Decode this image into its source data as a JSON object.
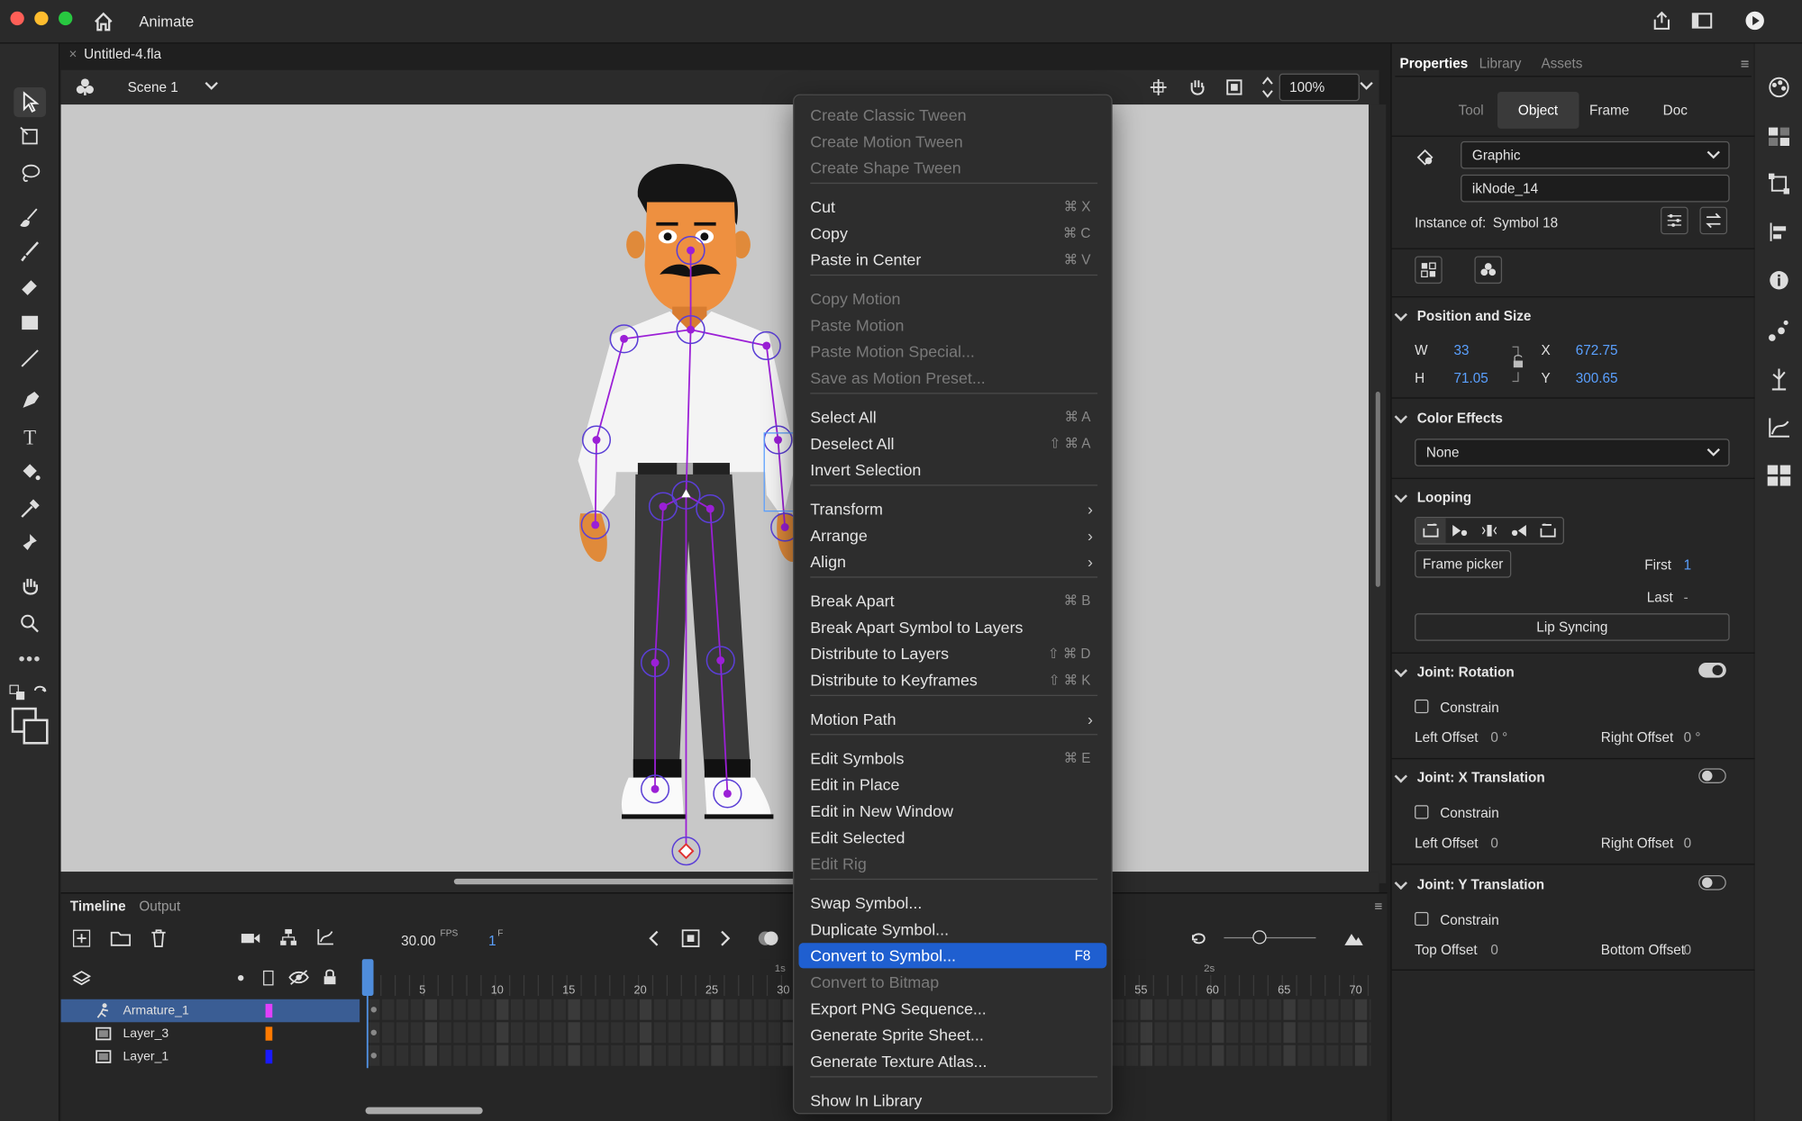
{
  "app": {
    "name": "Animate",
    "document_tab": "Untitled-4.fla"
  },
  "scene": {
    "label": "Scene 1",
    "zoom": "100%"
  },
  "menu": {
    "items": [
      {
        "label": "Create Classic Tween",
        "enabled": false
      },
      {
        "label": "Create Motion Tween",
        "enabled": false
      },
      {
        "label": "Create Shape Tween",
        "enabled": false
      },
      {
        "label": "Cut",
        "shortcut": "⌘ X",
        "enabled": true
      },
      {
        "label": "Copy",
        "shortcut": "⌘ C",
        "enabled": true
      },
      {
        "label": "Paste in Center",
        "shortcut": "⌘ V",
        "enabled": true
      },
      {
        "label": "Copy Motion",
        "enabled": false
      },
      {
        "label": "Paste Motion",
        "enabled": false
      },
      {
        "label": "Paste Motion Special...",
        "enabled": false
      },
      {
        "label": "Save as Motion Preset...",
        "enabled": false
      },
      {
        "label": "Select All",
        "shortcut": "⌘ A",
        "enabled": true
      },
      {
        "label": "Deselect All",
        "shortcut": "⇧ ⌘ A",
        "enabled": true
      },
      {
        "label": "Invert Selection",
        "enabled": true
      },
      {
        "label": "Transform",
        "submenu": true,
        "enabled": true
      },
      {
        "label": "Arrange",
        "submenu": true,
        "enabled": true
      },
      {
        "label": "Align",
        "submenu": true,
        "enabled": true
      },
      {
        "label": "Break Apart",
        "shortcut": "⌘ B",
        "enabled": true
      },
      {
        "label": "Break Apart Symbol to Layers",
        "enabled": true
      },
      {
        "label": "Distribute to Layers",
        "shortcut": "⇧ ⌘ D",
        "enabled": true
      },
      {
        "label": "Distribute to Keyframes",
        "shortcut": "⇧ ⌘ K",
        "enabled": true
      },
      {
        "label": "Motion Path",
        "submenu": true,
        "enabled": true
      },
      {
        "label": "Edit Symbols",
        "shortcut": "⌘ E",
        "enabled": true
      },
      {
        "label": "Edit in Place",
        "enabled": true
      },
      {
        "label": "Edit in New Window",
        "enabled": true
      },
      {
        "label": "Edit Selected",
        "enabled": true
      },
      {
        "label": "Edit Rig",
        "enabled": false
      },
      {
        "label": "Swap Symbol...",
        "enabled": true
      },
      {
        "label": "Duplicate Symbol...",
        "enabled": true
      },
      {
        "label": "Convert to Symbol...",
        "shortcut": "F8",
        "enabled": true,
        "highlighted": true
      },
      {
        "label": "Convert to Bitmap",
        "enabled": false
      },
      {
        "label": "Export PNG Sequence...",
        "enabled": true
      },
      {
        "label": "Generate Sprite Sheet...",
        "enabled": true
      },
      {
        "label": "Generate Texture Atlas...",
        "enabled": true
      },
      {
        "label": "Show In Library",
        "enabled": true
      }
    ]
  },
  "panel": {
    "tabs": [
      "Properties",
      "Library",
      "Assets"
    ],
    "subtabs": [
      "Tool",
      "Object",
      "Frame",
      "Doc"
    ],
    "symbol_type": "Graphic",
    "instance_name": "ikNode_14",
    "instance_of_label": "Instance of:",
    "instance_of": "Symbol 18",
    "position_size": {
      "title": "Position and Size",
      "w_label": "W",
      "w": "33",
      "h_label": "H",
      "h": "71.05",
      "x_label": "X",
      "x": "672.75",
      "y_label": "Y",
      "y": "300.65"
    },
    "color_effects": {
      "title": "Color Effects",
      "value": "None"
    },
    "looping": {
      "title": "Looping",
      "frame_picker": "Frame picker",
      "first_label": "First",
      "first": "1",
      "last_label": "Last",
      "last": "-",
      "lip_syncing": "Lip Syncing"
    },
    "joint_rotation": {
      "title": "Joint: Rotation",
      "constrain": "Constrain",
      "left_offset_label": "Left Offset",
      "left_offset": "0 °",
      "right_offset_label": "Right Offset",
      "right_offset": "0 °",
      "enabled": true
    },
    "joint_x": {
      "title": "Joint: X Translation",
      "constrain": "Constrain",
      "left_offset_label": "Left Offset",
      "left_offset": "0",
      "right_offset_label": "Right Offset",
      "right_offset": "0",
      "enabled": false
    },
    "joint_y": {
      "title": "Joint: Y Translation",
      "constrain": "Constrain",
      "top_offset_label": "Top Offset",
      "top_offset": "0",
      "bottom_offset_label": "Bottom Offset",
      "bottom_offset": "0",
      "enabled": false
    }
  },
  "timeline": {
    "tabs": [
      "Timeline",
      "Output"
    ],
    "fps": "30.00",
    "fps_unit": "FPS",
    "frame": "1",
    "frame_unit": "F",
    "layers": [
      {
        "name": "Armature_1",
        "color": "#e040fb"
      },
      {
        "name": "Layer_3",
        "color": "#ff7a00"
      },
      {
        "name": "Layer_1",
        "color": "#1a1aff"
      }
    ],
    "ruler_labels": [
      "5",
      "10",
      "15",
      "20",
      "25",
      "30",
      "55",
      "60",
      "65",
      "70"
    ],
    "second_markers": [
      "1s",
      "2s"
    ]
  }
}
